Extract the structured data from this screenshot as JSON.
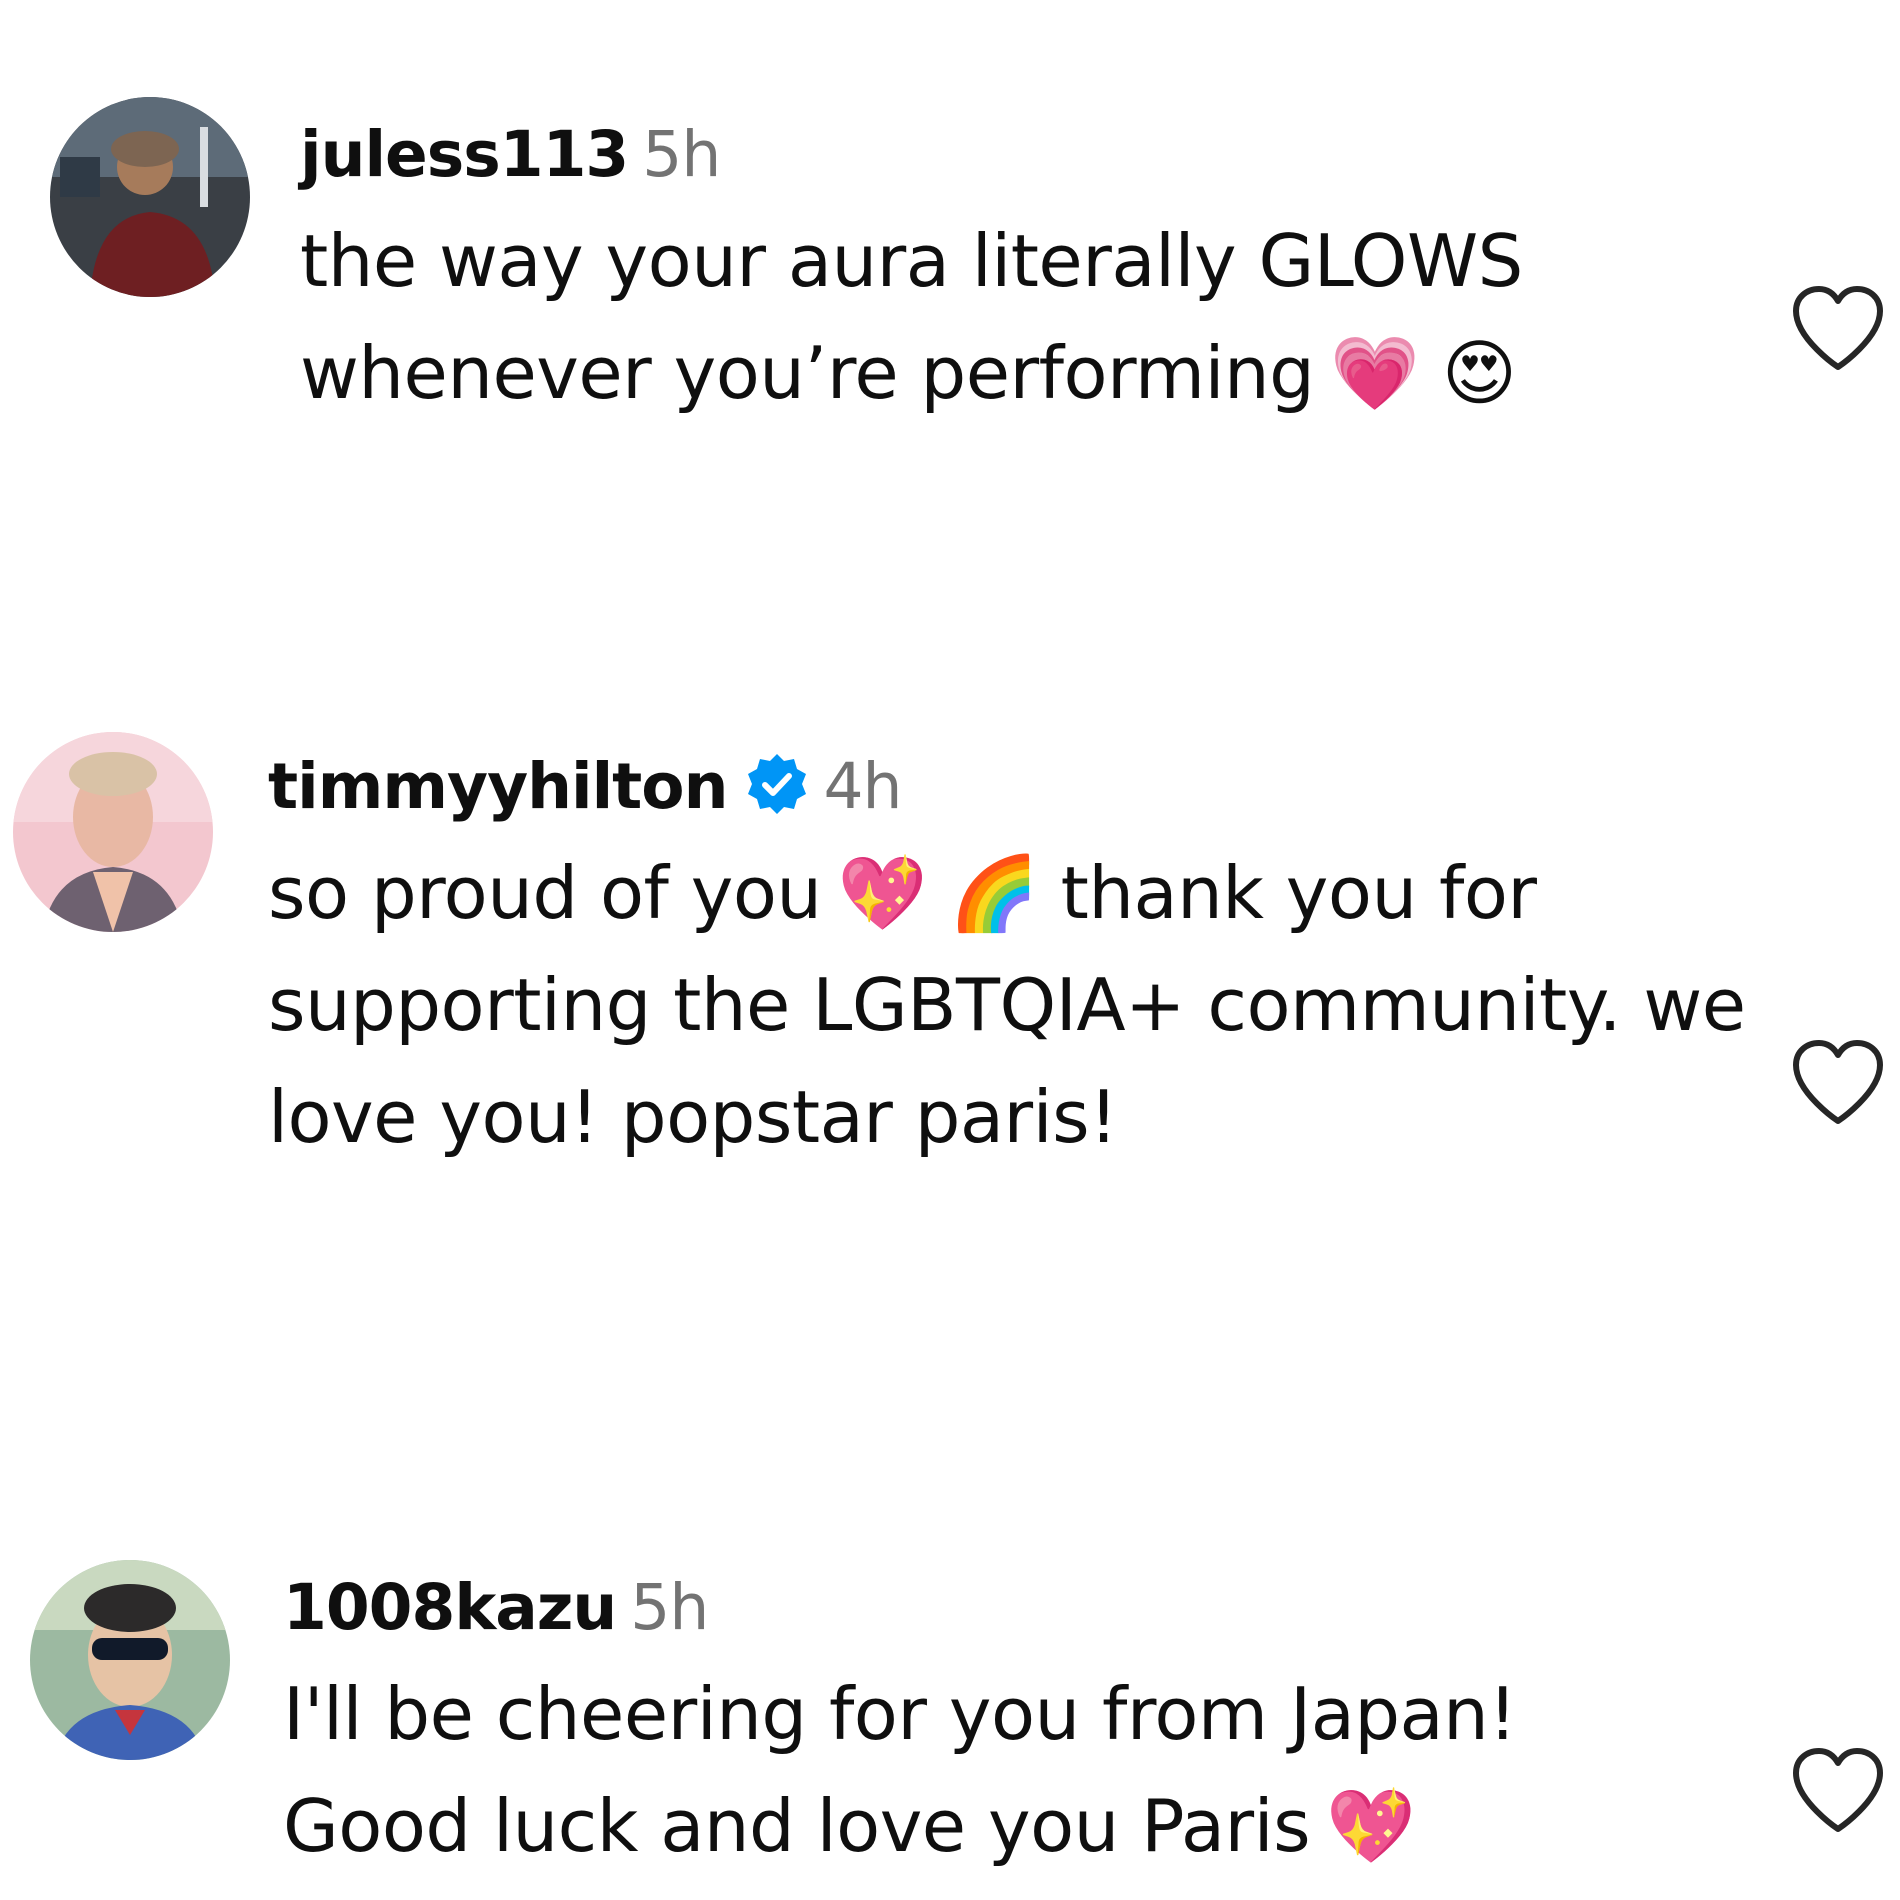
{
  "comments": [
    {
      "username": "juless113",
      "time": "5h",
      "verified": false,
      "text": "the way your aura literally GLOWS whenever you’re performing",
      "emojis": "💗 😍"
    },
    {
      "username": "timmyyhilton",
      "time": "4h",
      "verified": true,
      "text_start": "so proud of you",
      "emojis": "💖 🌈",
      "text_end": "thank you for supporting the LGBTQIA+ community. we love you! popstar paris!"
    },
    {
      "username": "1008kazu",
      "time": "5h",
      "verified": false,
      "text": "I'll be cheering for you from Japan! Good luck and love you Paris",
      "emojis": "💖"
    }
  ],
  "icons": {
    "like": "heart-outline-icon",
    "verified": "verified-badge-icon"
  },
  "colors": {
    "text": "#0f0f0f",
    "muted": "#737373",
    "verified": "#0095f6"
  }
}
